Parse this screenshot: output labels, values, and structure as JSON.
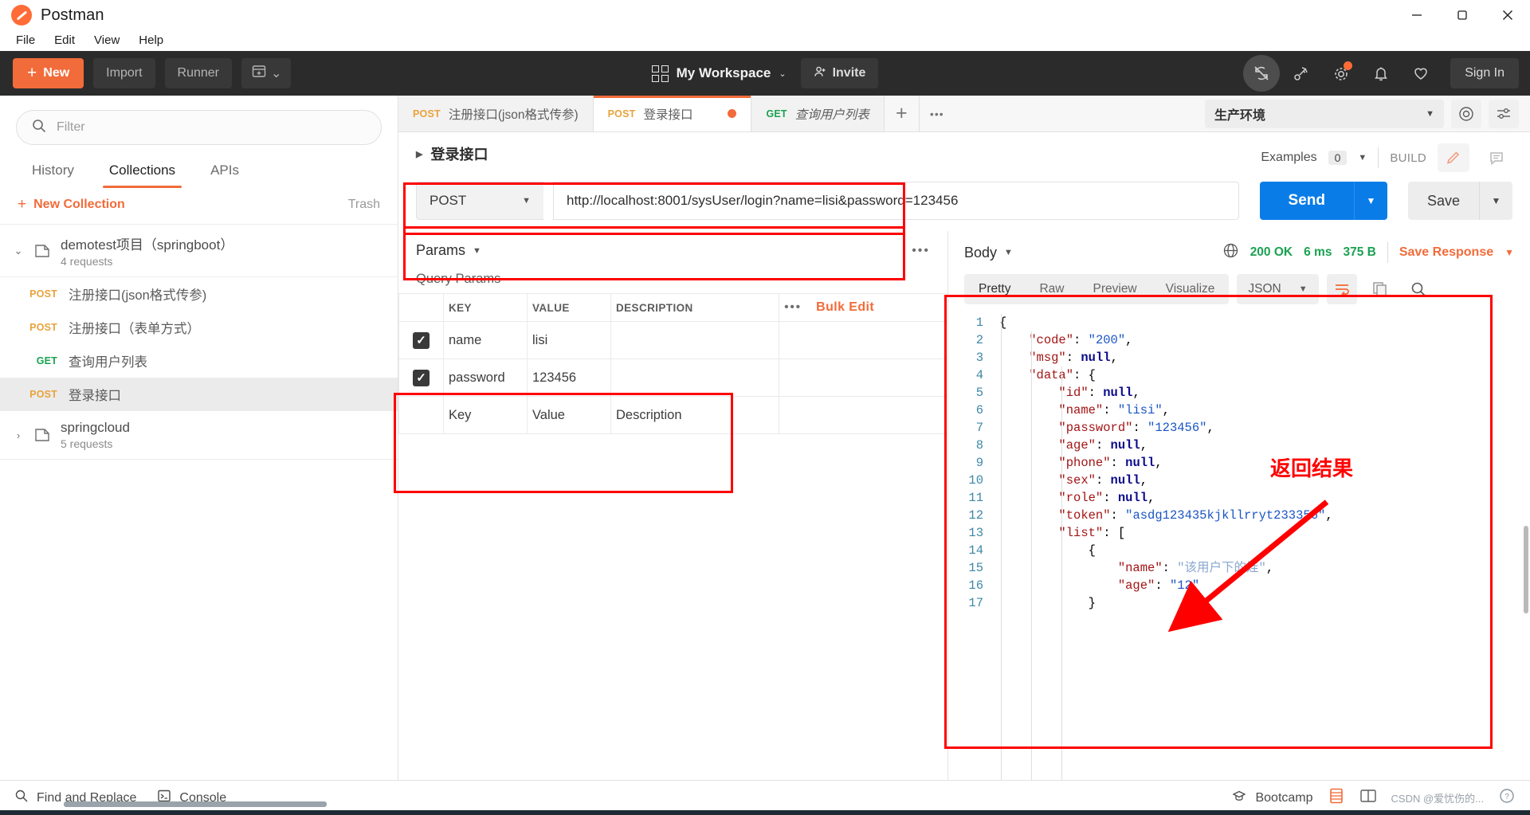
{
  "window": {
    "app_title": "Postman",
    "minimize": "minimize-icon",
    "maximize": "maximize-icon",
    "close": "close-icon"
  },
  "menu": [
    "File",
    "Edit",
    "View",
    "Help"
  ],
  "toolbar": {
    "new_label": "New",
    "import_label": "Import",
    "runner_label": "Runner",
    "workspace_label": "My Workspace",
    "invite_label": "Invite",
    "sign_in_label": "Sign In"
  },
  "sidebar": {
    "filter_placeholder": "Filter",
    "tabs": [
      {
        "label": "History",
        "active": false
      },
      {
        "label": "Collections",
        "active": true
      },
      {
        "label": "APIs",
        "active": false
      }
    ],
    "new_collection_label": "New Collection",
    "trash_label": "Trash",
    "collections": [
      {
        "name": "demotest项目（springboot）",
        "count": "4 requests",
        "expanded": true,
        "requests": [
          {
            "method": "POST",
            "name": "注册接口(json格式传参)",
            "selected": false
          },
          {
            "method": "POST",
            "name": "注册接口（表单方式）",
            "selected": false
          },
          {
            "method": "GET",
            "name": "查询用户列表",
            "selected": false
          },
          {
            "method": "POST",
            "name": "登录接口",
            "selected": true
          }
        ]
      },
      {
        "name": "springcloud",
        "count": "5 requests",
        "expanded": false,
        "requests": []
      }
    ]
  },
  "request_tabs": [
    {
      "method": "POST",
      "label": "注册接口(json格式传参)",
      "active": false,
      "unsaved": false,
      "italic": false
    },
    {
      "method": "POST",
      "label": "登录接口",
      "active": true,
      "unsaved": true,
      "italic": false
    },
    {
      "method": "GET",
      "label": "查询用户列表",
      "active": false,
      "unsaved": false,
      "italic": true
    }
  ],
  "environment": {
    "selected": "生产环境"
  },
  "request": {
    "title": "登录接口",
    "examples_label": "Examples",
    "examples_count": "0",
    "build_label": "BUILD",
    "method": "POST",
    "url": "http://localhost:8001/sysUser/login?name=lisi&password=123456",
    "send_label": "Send",
    "save_label": "Save"
  },
  "params": {
    "section_label": "Params",
    "query_params_label": "Query Params",
    "columns": [
      "KEY",
      "VALUE",
      "DESCRIPTION"
    ],
    "bulk_edit_label": "Bulk Edit",
    "rows": [
      {
        "checked": true,
        "key": "name",
        "value": "lisi",
        "description": ""
      },
      {
        "checked": true,
        "key": "password",
        "value": "123456",
        "description": ""
      }
    ],
    "placeholder_row": {
      "key": "Key",
      "value": "Value",
      "description": "Description"
    }
  },
  "response": {
    "body_label": "Body",
    "status": "200 OK",
    "time": "6 ms",
    "size": "375 B",
    "save_response_label": "Save Response",
    "views": [
      {
        "label": "Pretty",
        "active": true
      },
      {
        "label": "Raw",
        "active": false
      },
      {
        "label": "Preview",
        "active": false
      },
      {
        "label": "Visualize",
        "active": false
      }
    ],
    "format": "JSON",
    "code_lines": [
      {
        "no": "1",
        "text": "{"
      },
      {
        "no": "2",
        "text": "    \"code\": \"200\","
      },
      {
        "no": "3",
        "text": "    \"msg\": null,"
      },
      {
        "no": "4",
        "text": "    \"data\": {"
      },
      {
        "no": "5",
        "text": "        \"id\": null,"
      },
      {
        "no": "6",
        "text": "        \"name\": \"lisi\","
      },
      {
        "no": "7",
        "text": "        \"password\": \"123456\","
      },
      {
        "no": "8",
        "text": "        \"age\": null,"
      },
      {
        "no": "9",
        "text": "        \"phone\": null,"
      },
      {
        "no": "10",
        "text": "        \"sex\": null,"
      },
      {
        "no": "11",
        "text": "        \"role\": null,"
      },
      {
        "no": "12",
        "text": "        \"token\": \"asdg123435kjkllrryt233356\","
      },
      {
        "no": "13",
        "text": "        \"list\": ["
      },
      {
        "no": "14",
        "text": "            {"
      },
      {
        "no": "15",
        "text": "                \"name\": \"该用户下的娃\","
      },
      {
        "no": "16",
        "text": "                \"age\": \"12\""
      },
      {
        "no": "17",
        "text": "            }"
      }
    ]
  },
  "annotations": {
    "result_label": "返回结果"
  },
  "statusbar": {
    "find_replace_label": "Find and Replace",
    "console_label": "Console",
    "bootcamp_label": "Bootcamp",
    "watermark": "CSDN @爱忧伤的..."
  },
  "colors": {
    "accent": "#f26b3a",
    "send_blue": "#0a7ce8",
    "success_green": "#1aa251",
    "annotation_red": "#ff0000",
    "post_orange": "#e8a33d",
    "get_green": "#1aa251"
  }
}
